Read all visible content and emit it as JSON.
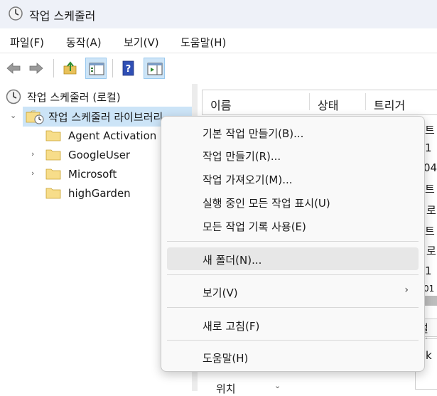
{
  "window": {
    "title": "작업 스케줄러"
  },
  "menubar": {
    "items": [
      "파일(F)",
      "동작(A)",
      "보기(V)",
      "도움말(H)"
    ]
  },
  "toolbar": {
    "buttons": [
      "back-icon",
      "forward-icon",
      "up-folder-icon",
      "show-tree-icon",
      "help-icon",
      "show-action-pane-icon"
    ]
  },
  "tree": {
    "root": "작업 스케줄러 (로컬)",
    "library": "작업 스케줄러 라이브러리",
    "children": [
      "Agent Activation",
      "GoogleUser",
      "Microsoft",
      "highGarden"
    ]
  },
  "list": {
    "columns": [
      "이름",
      "상태",
      "트리거"
    ],
    "peek_rows": [
      "트",
      "1",
      "04",
      "트",
      "로",
      "트",
      "로",
      "트",
      "1",
      "01"
    ],
    "lower_peek": "설정",
    "lower_peek2": "k",
    "bottom_peek": "위치"
  },
  "context_menu": {
    "items": [
      {
        "label": "기본 작업 만들기(B)..."
      },
      {
        "label": "작업 만들기(R)..."
      },
      {
        "label": "작업 가져오기(M)..."
      },
      {
        "label": "실행 중인 모든 작업 표시(U)"
      },
      {
        "label": "모든 작업 기록 사용(E)"
      },
      {
        "label": "새 폴더(N)..."
      },
      {
        "label": "보기(V)"
      },
      {
        "label": "새로 고침(F)"
      },
      {
        "label": "도움말(H)"
      }
    ],
    "hovered": "새 폴더(N)..."
  }
}
